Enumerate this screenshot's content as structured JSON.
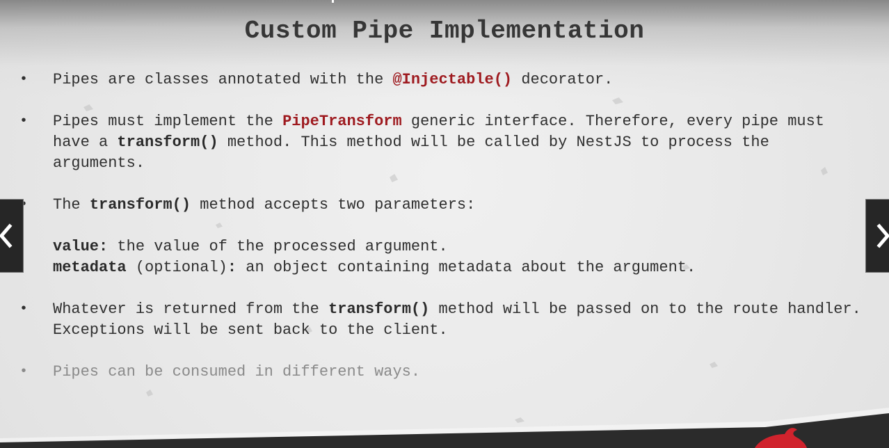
{
  "slide": {
    "title": "Custom Pipe Implementation",
    "bullets": [
      {
        "parts": [
          {
            "text": "Pipes are classes annotated with the "
          },
          {
            "text": "@Injectable()",
            "style": "red"
          },
          {
            "text": " decorator."
          }
        ]
      },
      {
        "parts": [
          {
            "text": "Pipes must implement the "
          },
          {
            "text": "PipeTransform",
            "style": "red"
          },
          {
            "text": " generic interface. Therefore, every pipe must have a "
          },
          {
            "text": "transform()",
            "style": "bold"
          },
          {
            "text": " method. This method will be called by NestJS to process the arguments."
          }
        ]
      },
      {
        "parts": [
          {
            "text": "The "
          },
          {
            "text": "transform()",
            "style": "bold"
          },
          {
            "text": " method accepts two parameters:"
          }
        ]
      },
      {
        "nobullet": true,
        "parts": [
          {
            "text": "value:",
            "style": "bold"
          },
          {
            "text": " the value of the processed argument."
          },
          {
            "text": "\n"
          },
          {
            "text": "metadata",
            "style": "bold"
          },
          {
            "text": " (optional)"
          },
          {
            "text": ":",
            "style": "bold"
          },
          {
            "text": " an object containing metadata about the argument."
          }
        ]
      },
      {
        "parts": [
          {
            "text": "Whatever is returned from the "
          },
          {
            "text": "transform()",
            "style": "bold"
          },
          {
            "text": " method will be passed on to the route handler. Exceptions will be sent back to the client."
          }
        ]
      },
      {
        "faded": true,
        "parts": [
          {
            "text": "Pipes can be consumed in different ways."
          }
        ]
      }
    ]
  },
  "navigation": {
    "prev_icon": "chevron-left-icon",
    "next_icon": "chevron-right-icon"
  },
  "colors": {
    "keyword_red": "#9e1a1f",
    "footer_dark": "#2b2b2b",
    "logo_red": "#d0232d"
  }
}
